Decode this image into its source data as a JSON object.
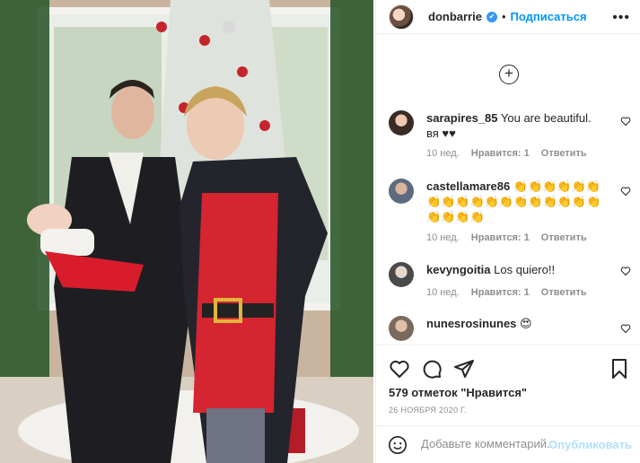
{
  "post": {
    "username": "donbarrie",
    "separator": "•",
    "follow_label": "Подписаться",
    "more_label": "•••",
    "likes": "579 отметок \"Нравится\"",
    "date": "26 ноября 2020 г.",
    "add_comment_placeholder": "Добавьте комментарий...",
    "publish_label": "Опубликовать"
  },
  "comments": [
    {
      "user": "sarapires_85",
      "text": "You are beautiful. вя ♥♥",
      "age": "10 нед.",
      "likes": "Нравится: 1",
      "reply": "Ответить"
    },
    {
      "user": "castellamare86",
      "text": "👏👏👏👏👏👏👏👏👏👏👏👏👏👏👏👏👏👏👏👏👏👏",
      "age": "10 нед.",
      "likes": "Нравится: 1",
      "reply": "Ответить"
    },
    {
      "user": "kevyngoitia",
      "text": "Los quiero!!",
      "age": "10 нед.",
      "likes": "Нравится: 1",
      "reply": "Ответить"
    },
    {
      "user": "nunesrosinunes",
      "text": "😍"
    }
  ],
  "colors": {
    "accent": "#0095f6",
    "muted": "#8e8e8e",
    "text": "#262626"
  },
  "icons": {
    "load_more": "plus-circle-icon",
    "like": "heart-icon",
    "comment": "comment-icon",
    "share": "paper-plane-icon",
    "save": "bookmark-icon",
    "emoji": "smiley-icon",
    "verified": "verified-badge-icon"
  }
}
